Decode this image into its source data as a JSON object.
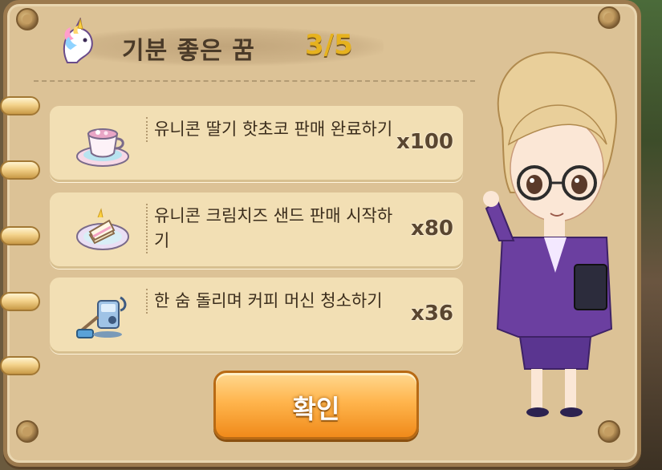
{
  "header": {
    "title": "기분 좋은 꿈",
    "progress": "3/5",
    "icon": "unicorn-icon"
  },
  "tasks": [
    {
      "text": "유니콘 딸기 핫초코 판매 완료하기",
      "count": "x100",
      "icon": "teacup-icon"
    },
    {
      "text": "유니콘 크림치즈 샌드 판매 시작하기",
      "count": "x80",
      "icon": "sandwich-plate-icon"
    },
    {
      "text": "한 숨 돌리며 커피 머신 청소하기",
      "count": "x36",
      "icon": "cleaning-tools-icon"
    }
  ],
  "confirm_label": "확인",
  "colors": {
    "board": "#dcc296",
    "task_card": "#f2dfb4",
    "progress": "#e6b21e",
    "button": "#ffb54d"
  }
}
